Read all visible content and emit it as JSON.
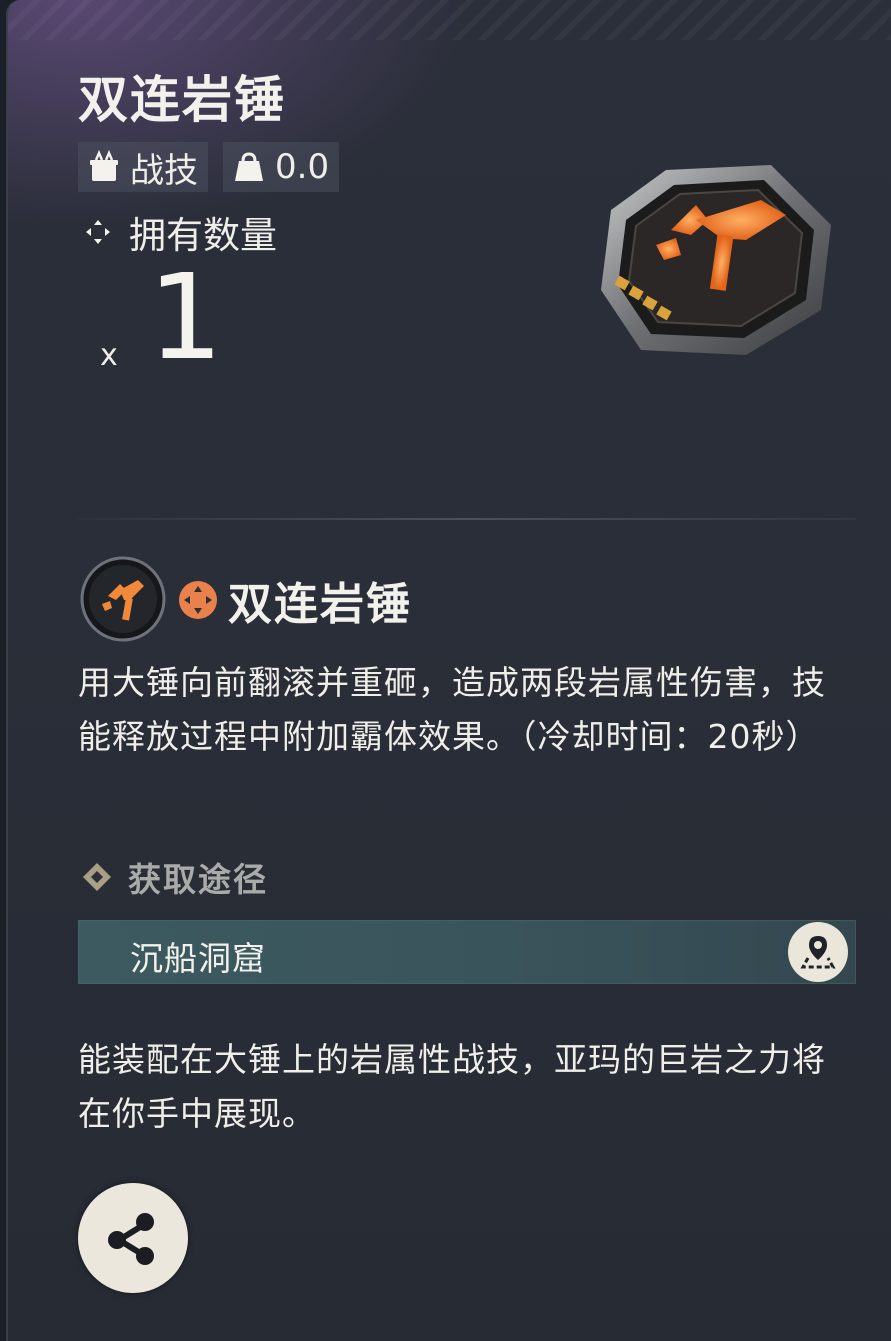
{
  "item": {
    "title": "双连岩锤",
    "type_tag": "战技",
    "weight": "0.0",
    "owned_label": "拥有数量",
    "quantity_prefix": "x",
    "quantity": "1"
  },
  "skill": {
    "name": "双连岩锤",
    "description": "用大锤向前翻滚并重砸，造成两段岩属性伤害，技能释放过程中附加霸体效果。（冷却时间：20秒）"
  },
  "obtain": {
    "heading": "获取途径",
    "location": "沉船洞窟"
  },
  "flavor_text": "能装配在大锤上的岩属性战技，亚玛的巨岩之力将在你手中展现。",
  "icons": {
    "type": "skill-chip-icon",
    "weight": "weight-bag-icon",
    "owned": "quantity-crosshair-icon",
    "attribute": "rock-element-icon",
    "map": "map-pin-icon",
    "share": "share-icon"
  },
  "colors": {
    "accent_orange": "#f08a3a",
    "location_bar": "#3c5a60",
    "button_bg": "#ebe7dc"
  }
}
